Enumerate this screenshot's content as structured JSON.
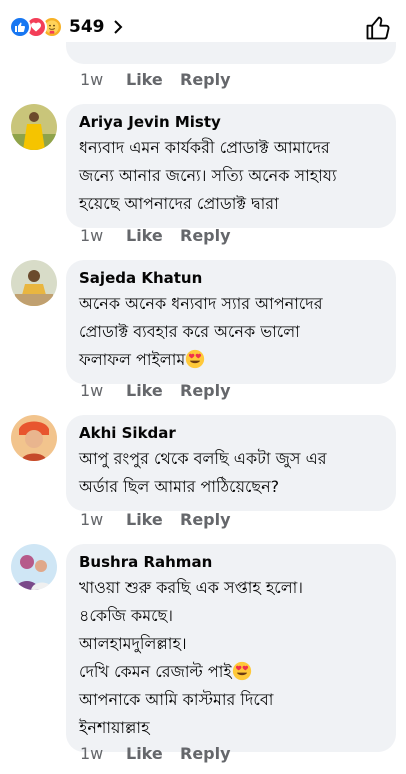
{
  "header": {
    "reaction_icons": [
      "like-reaction-icon",
      "love-reaction-icon",
      "care-reaction-icon"
    ],
    "reaction_count": "549"
  },
  "colors": {
    "like": "#1877f2",
    "love": "#f33e58",
    "care": "#f7b125",
    "bubble": "#f0f2f5",
    "meta": "#65676b"
  },
  "prev_actions": {
    "time": "1w",
    "like": "Like",
    "reply": "Reply"
  },
  "comments": [
    {
      "author": "Ariya Jevin Misty",
      "text": "ধন্যবাদ এমন কার্যকরী প্রোডাক্ট আমাদের\nজন্যে আনার জন্যে। সত্যি অনেক সাহায্য\nহয়েছে আপনাদের প্রোডাক্ট দ্বারা",
      "time": "1w",
      "like": "Like",
      "reply": "Reply"
    },
    {
      "author": "Sajeda Khatun",
      "text": "অনেক অনেক ধন্যবাদ স্যার আপনাদের\nপ্রোডাক্ট ব্যবহার করে অনেক ভালো\nফলাফল পাইলাম",
      "time": "1w",
      "like": "Like",
      "reply": "Reply"
    },
    {
      "author": "Akhi Sikdar",
      "text": "আপু রংপুর থেকে বলছি একটা জুস এর\nঅর্ডার ছিল আমার পাঠিয়েছেন?",
      "time": "1w",
      "like": "Like",
      "reply": "Reply"
    },
    {
      "author": "Bushra Rahman",
      "text_lines": [
        "খাওয়া শুরু করছি এক সপ্তাহ হলো।",
        "৪কেজি কমছে।",
        "আলহামদুলিল্লাহ।",
        "দেখি কেমন রেজাল্ট পাই",
        "আপনাকে আমি কাস্টমার দিবো",
        "ইনশায়াল্লাহ"
      ],
      "time": "1w",
      "like": "Like",
      "reply": "Reply"
    }
  ]
}
